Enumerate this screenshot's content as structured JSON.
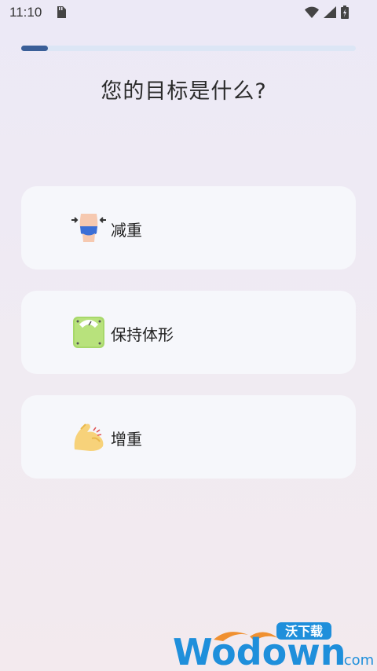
{
  "status_bar": {
    "time": "11:10",
    "icons": [
      "sd-card-icon",
      "wifi-icon",
      "signal-icon",
      "battery-icon"
    ]
  },
  "progress": {
    "fraction": 0.08
  },
  "title": "您的目标是什么?",
  "options": [
    {
      "label": "减重",
      "icon": "waist-slimming-icon"
    },
    {
      "label": "保持体形",
      "icon": "scale-icon"
    },
    {
      "label": "增重",
      "icon": "flexed-arm-icon"
    }
  ],
  "watermark": {
    "brand_cn": "沃下载",
    "brand_en": "Wodown",
    "tld": ".com"
  },
  "colors": {
    "accent": "#3a5f98",
    "track": "#dce6f5",
    "card": "#f6f7fb",
    "watermark": "#1f8fdb"
  }
}
